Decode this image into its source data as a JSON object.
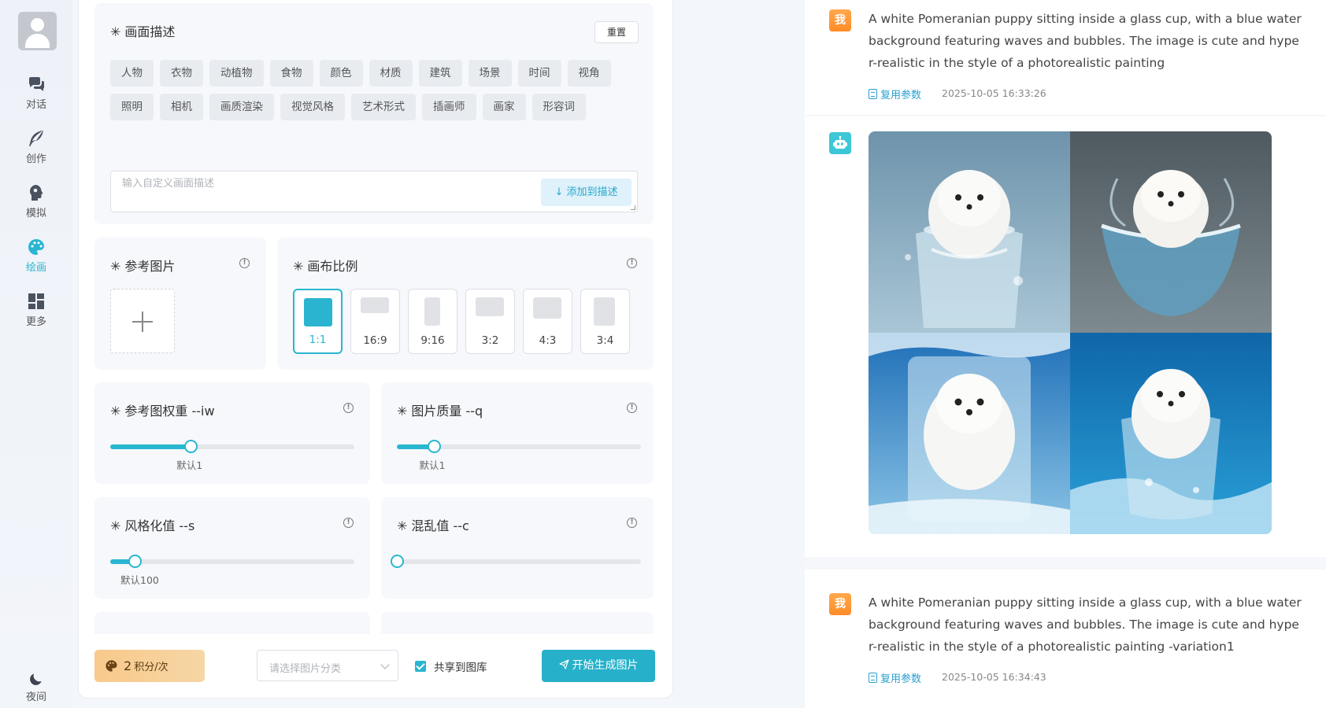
{
  "sidebar": {
    "items": [
      {
        "label": "对话",
        "icon": "chat-icon"
      },
      {
        "label": "创作",
        "icon": "feather-icon"
      },
      {
        "label": "模拟",
        "icon": "head-icon"
      },
      {
        "label": "绘画",
        "icon": "palette-icon",
        "active": true
      },
      {
        "label": "更多",
        "icon": "grid-icon"
      }
    ],
    "night": {
      "label": "夜间",
      "icon": "moon-icon"
    }
  },
  "description": {
    "title": "画面描述",
    "reset_label": "重置",
    "tags": [
      "人物",
      "衣物",
      "动植物",
      "食物",
      "颜色",
      "材质",
      "建筑",
      "场景",
      "时间",
      "视角",
      "照明",
      "相机",
      "画质渲染",
      "视觉风格",
      "艺术形式",
      "插画师",
      "画家",
      "形容词"
    ],
    "input_placeholder": "输入自定义画面描述",
    "add_label": "添加到描述"
  },
  "reference": {
    "title": "参考图片"
  },
  "canvas": {
    "title": "画布比例",
    "ratios": [
      "1:1",
      "16:9",
      "9:16",
      "3:2",
      "4:3",
      "3:4"
    ],
    "selected": "1:1"
  },
  "sliders": {
    "iw": {
      "title": "参考图权重 --iw",
      "hint": "默认1",
      "value_pct": 33
    },
    "q": {
      "title": "图片质量 --q",
      "hint": "默认1",
      "value_pct": 15
    },
    "s": {
      "title": "风格化值 --s",
      "hint": "默认100",
      "value_pct": 10
    },
    "c": {
      "title": "混乱值 --c",
      "hint": "",
      "value_pct": 0
    }
  },
  "footer": {
    "credits_value": "2",
    "credits_unit": "积分/次",
    "category_placeholder": "请选择图片分类",
    "share_label": "共享到图库",
    "share_checked": true,
    "generate_label": "开始生成图片"
  },
  "chat": {
    "messages": [
      {
        "role": "me",
        "avatar_text": "我",
        "text": "A white Pomeranian puppy sitting inside a glass cup, with a blue water background featuring waves and bubbles. The image is cute and hyper-realistic in the style of a photorealistic painting",
        "reuse_label": "复用参数",
        "time": "2025-10-05 16:33:26"
      },
      {
        "role": "bot",
        "image_caption": "4 generated images: white Pomeranian puppy in a glass cup with blue water splash"
      },
      {
        "role": "me",
        "avatar_text": "我",
        "text": "A white Pomeranian puppy sitting inside a glass cup, with a blue water background featuring waves and bubbles. The image is cute and hyper-realistic in the style of a photorealistic painting -variation1",
        "reuse_label": "复用参数",
        "time": "2025-10-05 16:34:43"
      }
    ]
  },
  "colors": {
    "accent": "#29b6d1",
    "credits_bg": "#f8c98b",
    "me_badge": "#ff8b27",
    "bot_badge": "#3cc7d6"
  }
}
